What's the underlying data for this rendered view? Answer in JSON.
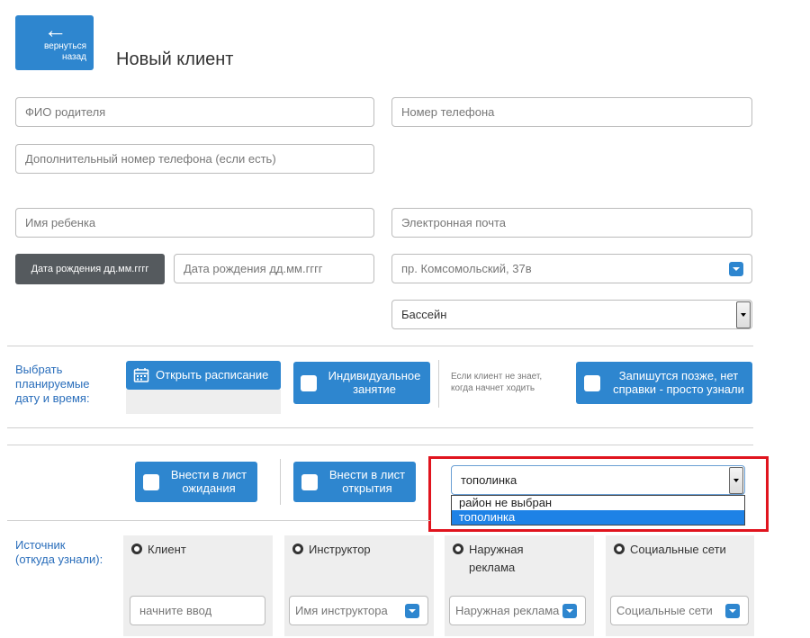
{
  "header": {
    "back_label_line1": "вернуться",
    "back_label_line2": "назад",
    "back_icon": "arrow-left-icon",
    "title": "Новый клиент"
  },
  "form": {
    "parent_name_placeholder": "ФИО родителя",
    "phone_placeholder": "Номер телефона",
    "extra_phone_placeholder": "Дополнительный номер телефона (если есть)",
    "child_name_placeholder": "Имя ребенка",
    "email_placeholder": "Электронная почта",
    "birthdate_button": "Дата рождения дд.мм.гггг",
    "birthdate_placeholder": "Дата рождения дд.мм.гггг",
    "address_value": "пр. Комсомольский, 37в",
    "facility_value": "Бассейн"
  },
  "schedule": {
    "label": "Выбрать планируемые дату и время:",
    "open_schedule_label": "Открыть расписание",
    "calendar_icon": "calendar-icon",
    "individual_label_line1": "Индивидуальное",
    "individual_label_line2": "занятие",
    "note_line1": "Если клиент не знает,",
    "note_line2": "когда начнет ходить",
    "later_label_line1": "Запишутся позже, нет",
    "later_label_line2": "справки - просто узнали"
  },
  "lists": {
    "waiting_line1": "Внести в лист",
    "waiting_line2": "ожидания",
    "opening_line1": "Внести в лист",
    "opening_line2": "открытия",
    "district_value": "тополинка",
    "district_options": [
      "район не выбран",
      "тополинка"
    ],
    "district_selected_index": 1,
    "highlight_color": "#e0141e"
  },
  "source": {
    "label_line1": "Источник",
    "label_line2": "(откуда узнали):",
    "options": [
      {
        "label": "Клиент",
        "input_placeholder": "начните ввод"
      },
      {
        "label": "Инструктор",
        "input_placeholder": "Имя инструктора"
      },
      {
        "label_line1": "Наружная",
        "label_line2": "реклама",
        "input_placeholder": "Наружная реклама"
      },
      {
        "label": "Социальные сети",
        "input_placeholder": "Социальные сети"
      }
    ]
  },
  "colors": {
    "accent": "#2e86cf",
    "dark_button": "#555a5e",
    "label_blue": "#2a6ebb",
    "panel_gray": "#eeeeee"
  }
}
